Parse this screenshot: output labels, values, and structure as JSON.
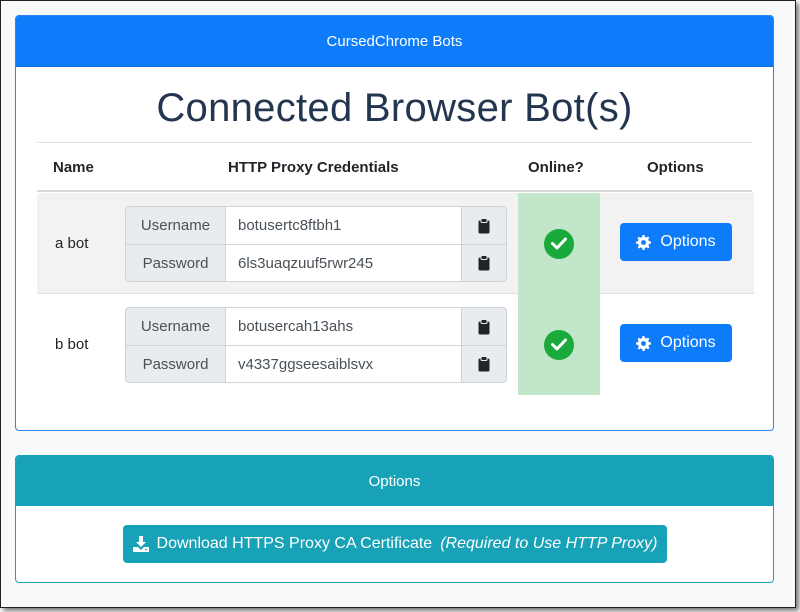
{
  "bots_card": {
    "header": "CursedChrome Bots",
    "title": "Connected Browser Bot(s)",
    "columns": {
      "name": "Name",
      "credentials": "HTTP Proxy Credentials",
      "online": "Online?",
      "options": "Options"
    },
    "rows": [
      {
        "name": "a bot",
        "username_label": "Username",
        "username": "botusertc8ftbh1",
        "password_label": "Password",
        "password": "6ls3uaqzuuf5rwr245",
        "online": true,
        "options_label": "Options"
      },
      {
        "name": "b bot",
        "username_label": "Username",
        "username": "botusercah13ahs",
        "password_label": "Password",
        "password": "v4337ggseesaiblsvx",
        "online": true,
        "options_label": "Options"
      }
    ]
  },
  "options_card": {
    "header": "Options",
    "download_label": "Download HTTPS Proxy CA Certificate",
    "download_note": "(Required to Use HTTP Proxy)"
  },
  "icons": {
    "clipboard": "clipboard-icon",
    "check": "check-circle-icon",
    "gear": "gear-icon",
    "download": "download-icon"
  },
  "colors": {
    "primary": "#0d7cfb",
    "info": "#17a2b8",
    "success": "#1aaa3b",
    "online_cell": "#c2e6c9"
  }
}
